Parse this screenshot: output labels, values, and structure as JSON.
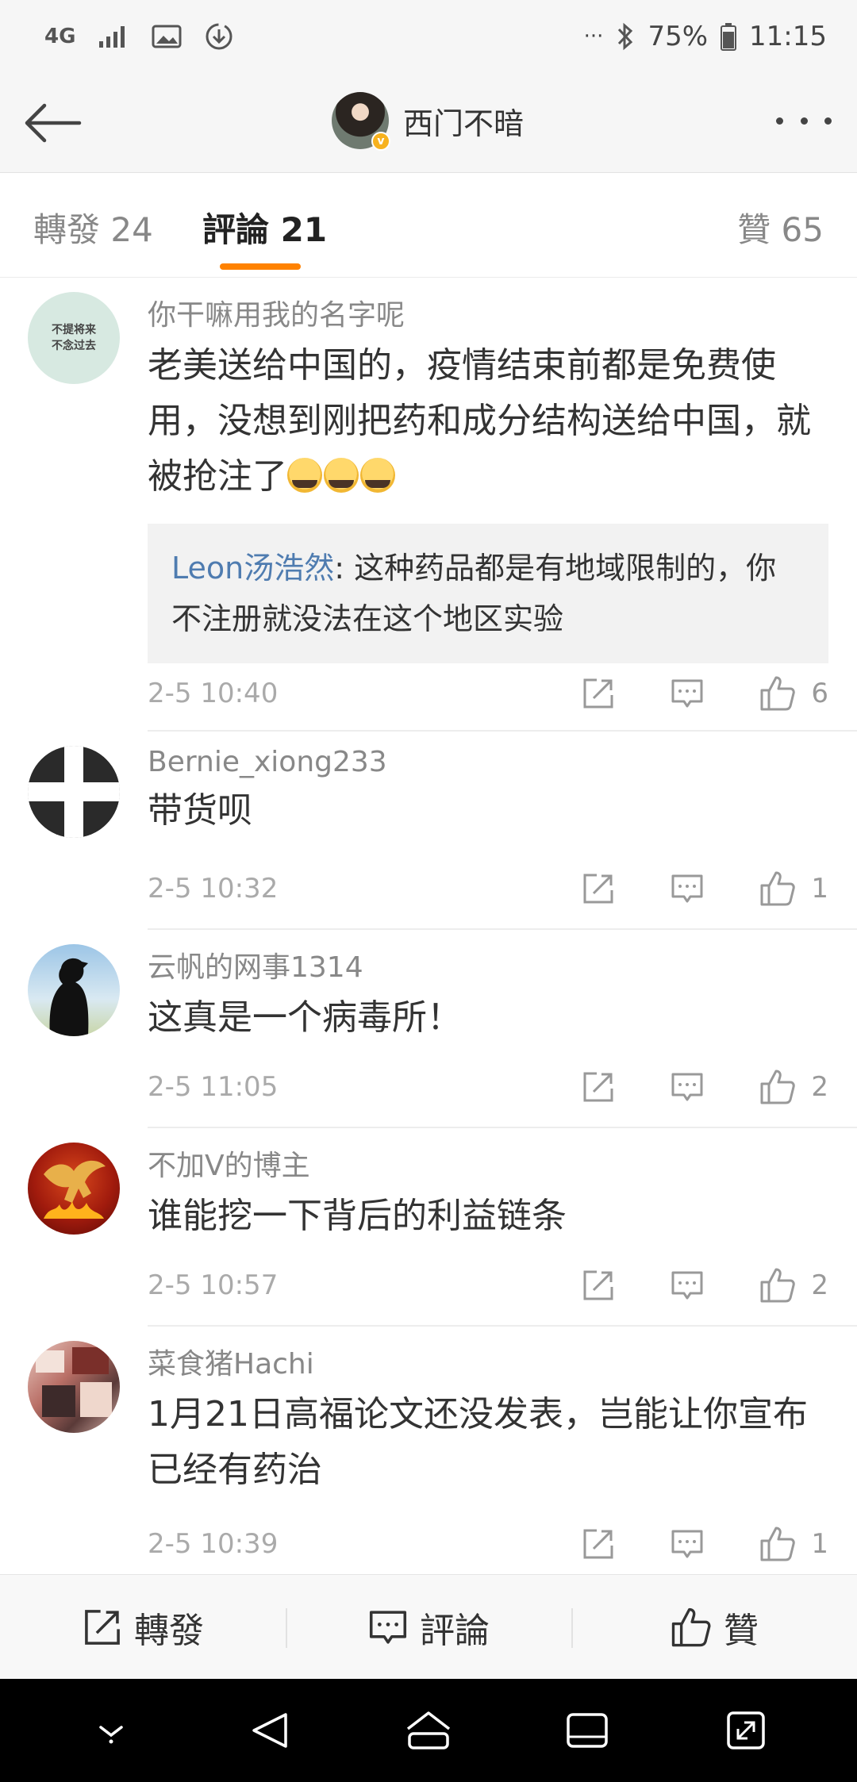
{
  "status": {
    "network": "4G",
    "battery": "75%",
    "time": "11:15"
  },
  "header": {
    "title": "西门不暗"
  },
  "tabs": {
    "repost": "轉發 24",
    "comments": "評論 21",
    "likes": "贊 65"
  },
  "comments": [
    {
      "name": "你干嘛用我的名字呢",
      "text": "老美送给中国的，疫情结束前都是免费使用，没想到刚把药和成分结构送给中国，就被抢注了",
      "emoji_count": 3,
      "reply": {
        "name": "Leon汤浩然",
        "text": ": 这种药品都是有地域限制的，你不注册就没法在这个地区实验"
      },
      "time": "2-5 10:40",
      "likes": "6",
      "avatar_text": "不提将来 不念过去"
    },
    {
      "name": "Bernie_xiong233",
      "text": "带货呗",
      "time": "2-5 10:32",
      "likes": "1"
    },
    {
      "name": "云帆的网事1314",
      "text": "这真是一个病毒所！",
      "time": "2-5 11:05",
      "likes": "2"
    },
    {
      "name": "不加V的博主",
      "text": "谁能挖一下背后的利益链条",
      "time": "2-5 10:57",
      "likes": "2"
    },
    {
      "name": "菜食猪Hachi",
      "text": "1月21日高福论文还没发表，岂能让你宣布已经有药治",
      "time": "2-5 10:39",
      "likes": "1"
    }
  ],
  "bottom": {
    "repost": "轉發",
    "comment": "評論",
    "like": "贊"
  },
  "colors": {
    "accent": "#ff8200",
    "link": "#4f7cb0"
  }
}
